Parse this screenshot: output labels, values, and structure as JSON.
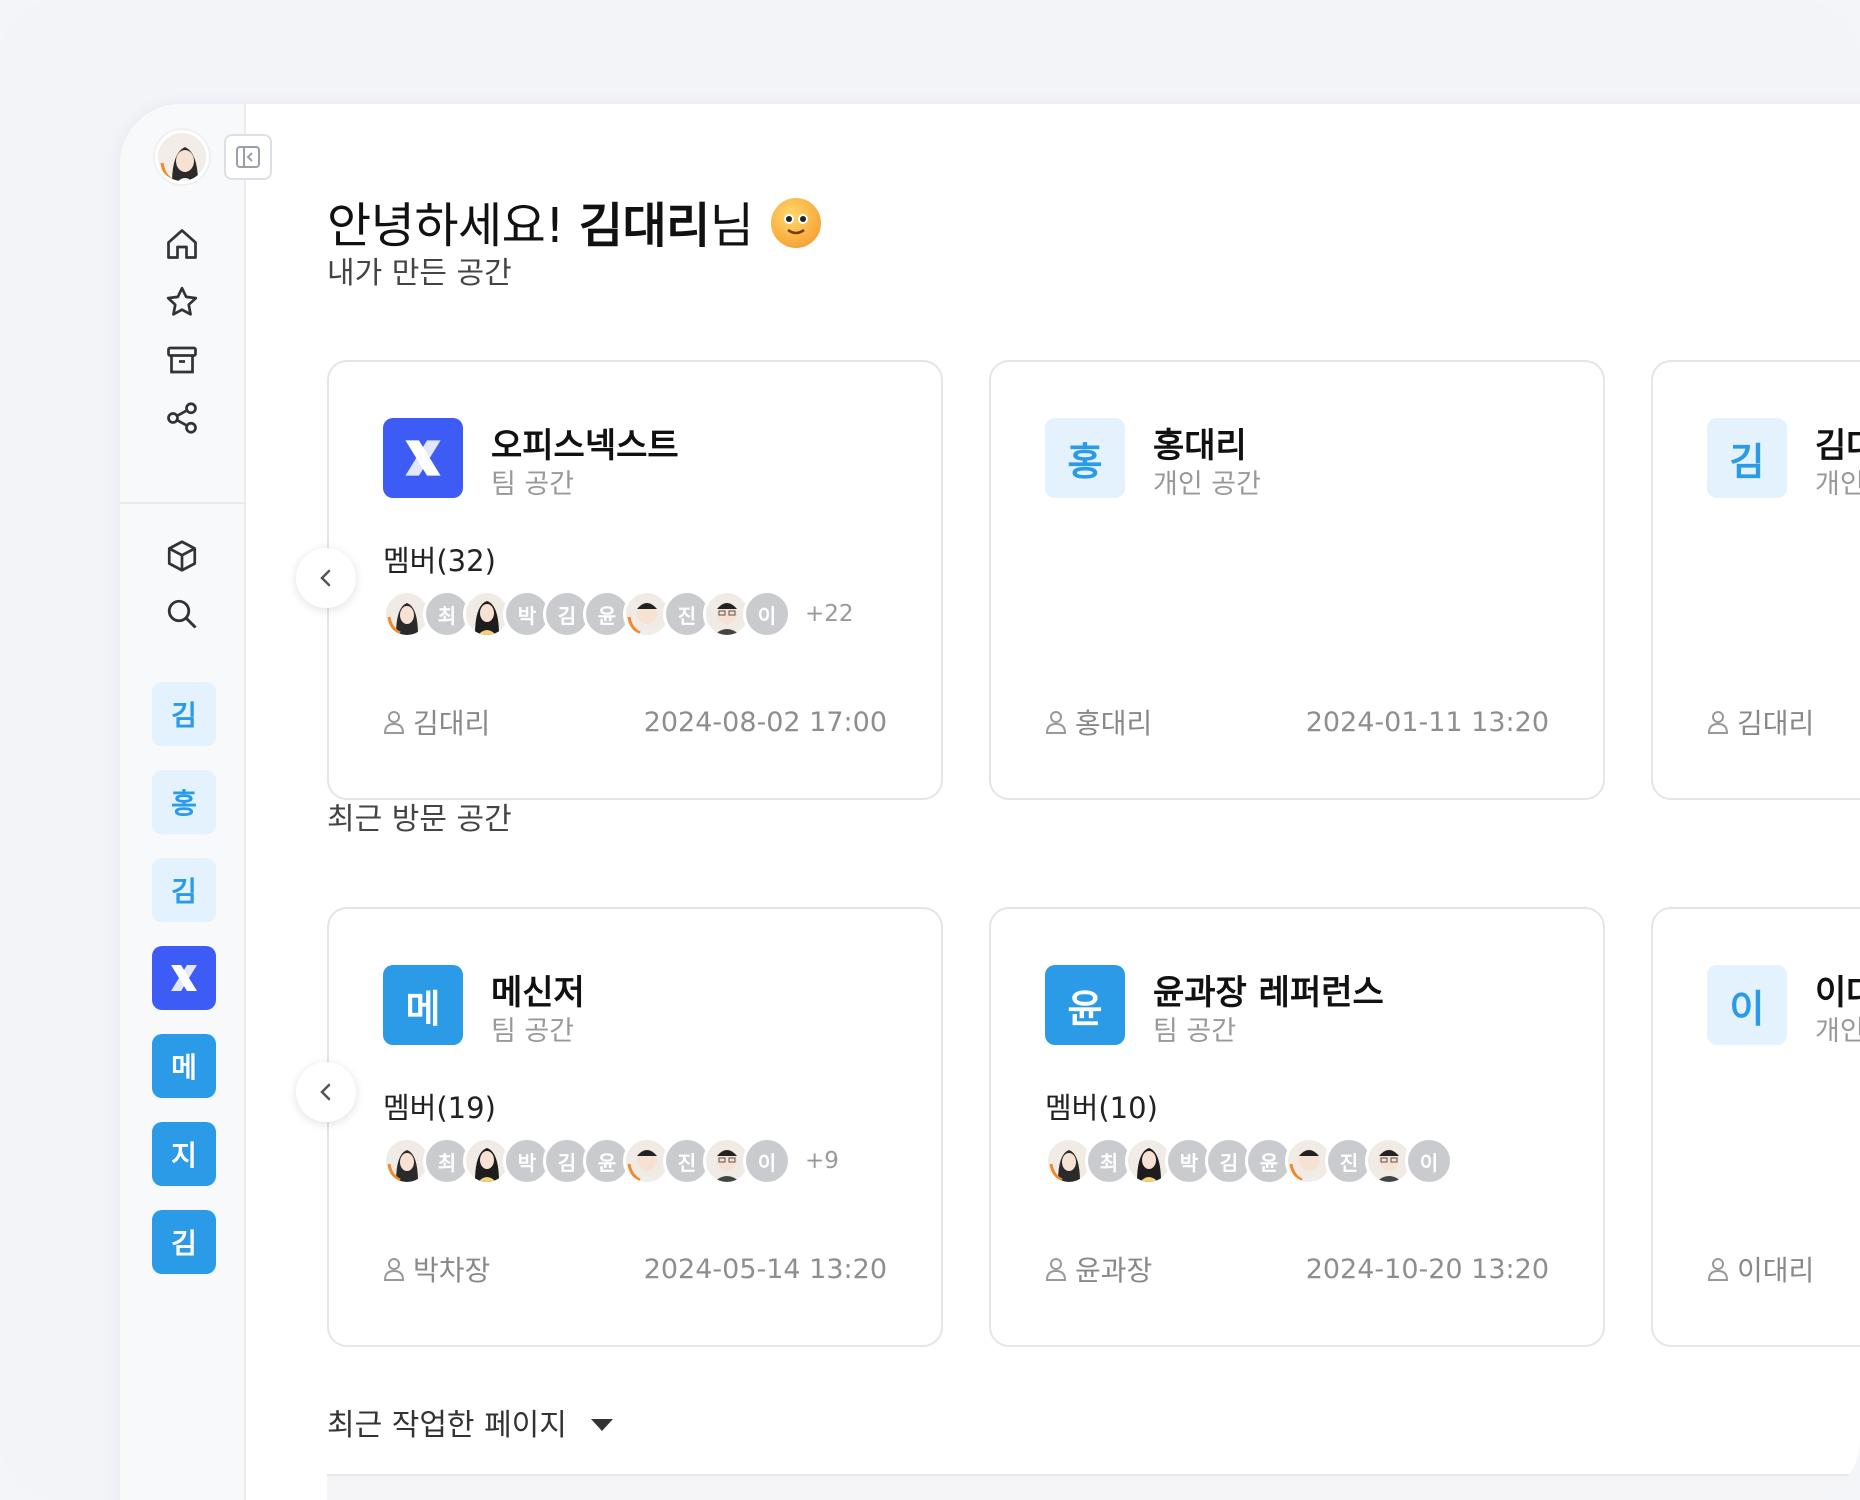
{
  "greeting": {
    "prefix": "안녕하세요! ",
    "name": "김대리",
    "suffix": "님"
  },
  "sidebar": {
    "nav_icons": [
      "home-icon",
      "star-icon",
      "archive-icon",
      "share-icon",
      "cube-icon",
      "search-icon"
    ],
    "spaces": [
      {
        "label": "김",
        "style": "light"
      },
      {
        "label": "홍",
        "style": "light"
      },
      {
        "label": "김",
        "style": "light"
      },
      {
        "label": "X",
        "style": "x"
      },
      {
        "label": "메",
        "style": "blue"
      },
      {
        "label": "지",
        "style": "blue"
      },
      {
        "label": "김",
        "style": "blue"
      }
    ]
  },
  "sections": {
    "my_spaces": "내가 만든 공간",
    "recent_spaces": "최근 방문 공간",
    "recent_pages": "최근 작업한 페이지"
  },
  "my_spaces_cards": [
    {
      "tile": "X",
      "name": "오피스넥스트",
      "type": "팀 공간",
      "members_label": "멤버(32)",
      "avatars": [
        "photo-f",
        "최",
        "photo-f2",
        "박",
        "김",
        "윤",
        "photo-m",
        "진",
        "photo-m2",
        "이"
      ],
      "more": "+22",
      "owner": "김대리",
      "date": "2024-08-02 17:00"
    },
    {
      "tile": "홍",
      "name": "홍대리",
      "type": "개인 공간",
      "owner": "홍대리",
      "date": "2024-01-11 13:20"
    },
    {
      "tile": "김",
      "name": "김대",
      "type": "개인 공",
      "owner": "김대리"
    }
  ],
  "recent_cards": [
    {
      "tile": "메",
      "name": "메신저",
      "type": "팀 공간",
      "members_label": "멤버(19)",
      "avatars": [
        "photo-f",
        "최",
        "photo-f2",
        "박",
        "김",
        "윤",
        "photo-m",
        "진",
        "photo-m2",
        "이"
      ],
      "more": "+9",
      "owner": "박차장",
      "date": "2024-05-14 13:20"
    },
    {
      "tile": "윤",
      "name": "윤과장 레퍼런스",
      "type": "팀 공간",
      "members_label": "멤버(10)",
      "avatars": [
        "photo-f",
        "최",
        "photo-f2",
        "박",
        "김",
        "윤",
        "photo-m",
        "진",
        "photo-m2",
        "이"
      ],
      "owner": "윤과장",
      "date": "2024-10-20 13:20"
    },
    {
      "tile": "이",
      "name": "이대",
      "type": "개인 공",
      "owner": "이대리"
    }
  ],
  "colors": {
    "accent_blue": "#2b9be8",
    "accent_x": "#3d5cf5",
    "tile_light": "#e3f2fd"
  }
}
